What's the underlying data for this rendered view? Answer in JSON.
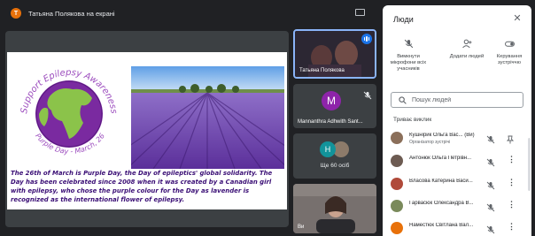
{
  "topbar": {
    "initial": "Т",
    "title": "Татьяна Полякова на екрані"
  },
  "slide": {
    "logo_arc_top": "Support Epilepsy Awareness",
    "logo_arc_bottom": "Purple Day - March, 26",
    "text": "The 26th of March is Purple Day, the Day of epileptics' global solidarity. The Day has been celebrated since 2008 when it was created by a Canadian girl with epilepsy, who chose the purple colour for the Day as lavender is recognized as the international flower of epilepsy."
  },
  "tiles": {
    "presenter_name": "Татьяна Полякова",
    "m_initial": "M",
    "m_name": "Mannanthra Adhwith Sant...",
    "h_initial": "H",
    "more_count": "Ще 60 осіб",
    "self_label": "Ви"
  },
  "panel": {
    "title": "Люди",
    "actions": [
      {
        "label": "Вимкнути мікрофони всіх учасників",
        "icon": "mic-off-icon"
      },
      {
        "label": "Додати людей",
        "icon": "add-person-icon"
      },
      {
        "label": "Керування зустріччю",
        "icon": "toggle-icon"
      }
    ],
    "search_placeholder": "Пошук людей",
    "section": "Триває виклик",
    "people": [
      {
        "name": "Кушнірик Ольга Вас...  (Ви)",
        "sub": "Організатор зустрічі",
        "color": "#8b6f5a",
        "right": "pin"
      },
      {
        "name": "Антонюк Ольга Петрівн...",
        "sub": "",
        "color": "#6d5b52",
        "right": "more"
      },
      {
        "name": "Власова Катерина Васи...",
        "sub": "",
        "color": "#b04a3a",
        "right": "more"
      },
      {
        "name": "Гарвасюк Олександра В...",
        "sub": "",
        "color": "#7a8a5b",
        "right": "more"
      },
      {
        "name": "Наместюк Світлана Вал...",
        "sub": "",
        "color": "#e8710a",
        "right": "more"
      }
    ]
  },
  "colors": {
    "accent": "#1a73e8",
    "slide_text": "#3a0e75",
    "presenter_border": "#8ab4f8"
  }
}
